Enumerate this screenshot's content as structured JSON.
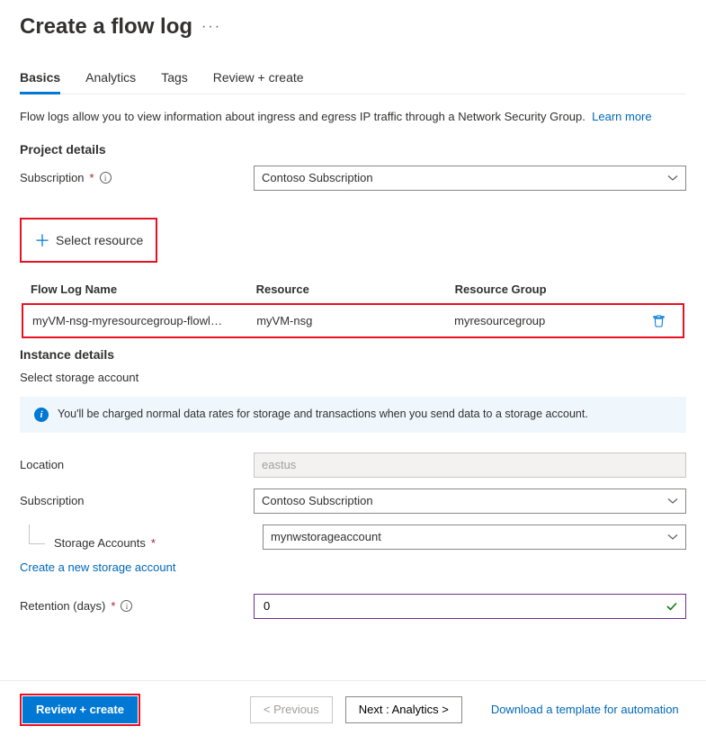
{
  "header": {
    "title": "Create a flow log"
  },
  "tabs": {
    "items": [
      "Basics",
      "Analytics",
      "Tags",
      "Review + create"
    ],
    "active": 0
  },
  "intro": {
    "text": "Flow logs allow you to view information about ingress and egress IP traffic through a Network Security Group.",
    "learn_more": "Learn more"
  },
  "project": {
    "section_title": "Project details",
    "subscription_label": "Subscription",
    "subscription_value": "Contoso Subscription",
    "select_resource_label": "Select resource"
  },
  "resource_table": {
    "cols": {
      "flowlog": "Flow Log Name",
      "resource": "Resource",
      "rg": "Resource Group"
    },
    "row": {
      "flowlog": "myVM-nsg-myresourcegroup-flowl…",
      "resource": "myVM-nsg",
      "rg": "myresourcegroup"
    }
  },
  "instance": {
    "section_title": "Instance details",
    "storage_subtitle": "Select storage account",
    "banner": "You'll be charged normal data rates for storage and transactions when you send data to a storage account.",
    "location_label": "Location",
    "location_value": "eastus",
    "subscription_label": "Subscription",
    "subscription_value": "Contoso Subscription",
    "storage_label": "Storage Accounts",
    "storage_value": "mynwstorageaccount",
    "create_storage_link": "Create a new storage account",
    "retention_label": "Retention (days)",
    "retention_value": "0"
  },
  "footer": {
    "review": "Review + create",
    "prev": "< Previous",
    "next": "Next : Analytics >",
    "download": "Download a template for automation"
  }
}
